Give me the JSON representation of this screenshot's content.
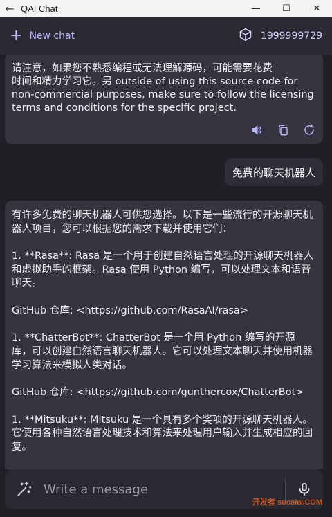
{
  "window": {
    "title": "QAI Chat",
    "minimize_label": "—",
    "maximize_label": "☐",
    "close_label": "✕"
  },
  "header": {
    "new_chat_label": "New chat",
    "credits_value": "1999999729"
  },
  "messages": [
    {
      "role": "assistant",
      "text": "请注意，如果您不熟悉编程或无法理解源码，可能需要花费\n时间和精力学习它。另 outside of using this source code for\nnon-commercial purposes, make sure to follow the licensing\nterms and conditions for the specific project."
    },
    {
      "role": "user",
      "text": "免费的聊天机器人"
    },
    {
      "role": "assistant",
      "paragraphs": [
        "有许多免费的聊天机器人可供您选择。以下是一些流行的开源聊天机器人项目，您可以根据您的需求下载并使用它们：",
        "1. **Rasa**: Rasa 是一个用于创建自然语言处理的开源聊天机器人和虚拟助手的框架。Rasa 使用 Python 编写，可以处理文本和语音聊天。",
        "GitHub 仓库: <https://github.com/RasaAI/rasa>",
        "1. **ChatterBot**: ChatterBot 是一个用 Python 编写的开源库，可以创建自然语言聊天机器人。它可以处理文本聊天并使用机器学习算法来模拟人类对话。",
        "GitHub 仓库: <https://github.com/gunthercox/ChatterBot>",
        "1. **Mitsuku**: Mitsuku 是一个具有多个奖项的开源聊天机器人。它使用各种自然语言处理技术和算法来处理用户输入并生成相应的回复。"
      ]
    }
  ],
  "input": {
    "placeholder": "Write a message"
  },
  "watermark": "开发者 sucaiw.COM"
}
